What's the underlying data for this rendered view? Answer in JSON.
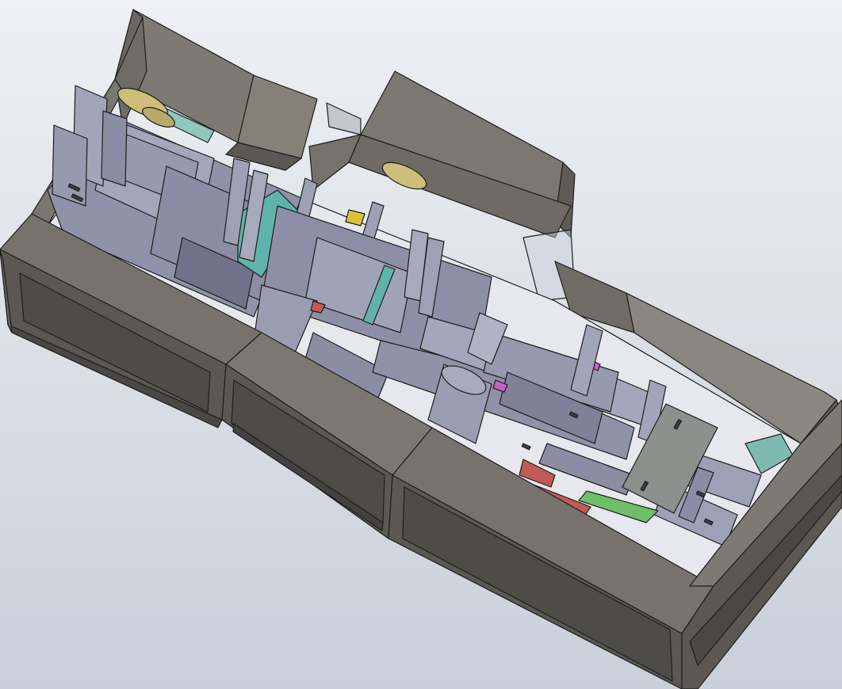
{
  "scene": {
    "kind": "cad-3d-model-viewport",
    "subject": "machine-assembly",
    "colors": {
      "background_top": "#eef0f4",
      "background_bottom": "#c9cfd9",
      "housing": "#77736c",
      "housing_shade": "#5b5853",
      "housing_dark": "#4a4844",
      "frame": "#8f92a8",
      "frame_light": "#a4a7bb",
      "frame_dark": "#6f7288",
      "teal_part": "#5fb3aa",
      "gear": "#cdbf7a",
      "red_part": "#c25a55",
      "green_part": "#6fbf6a",
      "magenta_part": "#c65fc7",
      "yellow_part": "#d8c23a",
      "plate": "#8d908c",
      "edge": "#1e1e1e"
    }
  }
}
